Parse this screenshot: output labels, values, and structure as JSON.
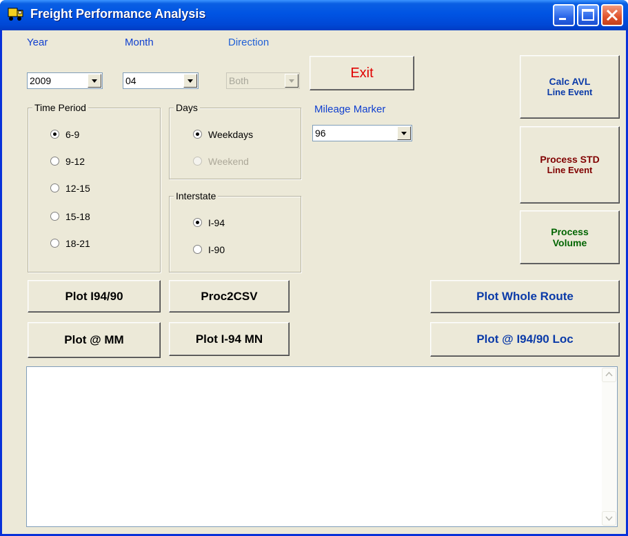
{
  "window": {
    "title": "Freight Performance Analysis"
  },
  "filters": {
    "year": {
      "label": "Year",
      "value": "2009"
    },
    "month": {
      "label": "Month",
      "value": "04"
    },
    "direction": {
      "label": "Direction",
      "value": "Both",
      "enabled": false
    },
    "mileage_marker": {
      "label": "Mileage Marker",
      "value": "96"
    }
  },
  "time_period": {
    "title": "Time Period",
    "options": [
      "6-9",
      "9-12",
      "12-15",
      "15-18",
      "18-21"
    ],
    "selected": "6-9"
  },
  "days": {
    "title": "Days",
    "options": [
      "Weekdays",
      "Weekend"
    ],
    "selected": "Weekdays"
  },
  "interstate": {
    "title": "Interstate",
    "options": [
      "I-94",
      "I-90"
    ],
    "selected": "I-94"
  },
  "buttons": {
    "exit": "Exit",
    "calc_avl_1": "Calc AVL",
    "calc_avl_2": "Line Event",
    "process_std_1": "Process STD",
    "process_std_2": "Line Event",
    "process_volume_1": "Process",
    "process_volume_2": "Volume",
    "plot_i94_90": "Plot I94/90",
    "proc2csv": "Proc2CSV",
    "plot_whole_route": "Plot Whole Route",
    "plot_at_mm": "Plot @ MM",
    "plot_i94_mn": "Plot I-94 MN",
    "plot_at_i94_90_loc": "Plot @ I94/90 Loc"
  },
  "colors": {
    "exit_text": "#e00000",
    "calc_avl_text": "#0a3aa8",
    "process_std_text": "#800000",
    "process_volume_text": "#006400",
    "plot_right_text": "#0a3aa8",
    "label_blue": "#1f4fd6"
  },
  "output": {
    "value": ""
  }
}
